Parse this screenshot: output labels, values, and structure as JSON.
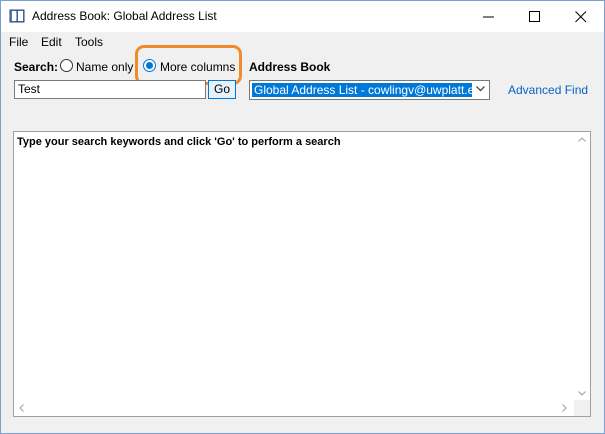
{
  "window": {
    "title": "Address Book: Global Address List",
    "icon": "address-book-icon"
  },
  "menu": [
    "File",
    "Edit",
    "Tools"
  ],
  "search": {
    "label": "Search:",
    "options": [
      {
        "label": "Name only",
        "selected": false
      },
      {
        "label": "More columns",
        "selected": true
      }
    ],
    "input_value": "Test",
    "go_label": "Go"
  },
  "address_book": {
    "label": "Address Book",
    "selected": "Global Address List - cowlingv@uwplatt.e"
  },
  "advanced_find": "Advanced Find",
  "results": {
    "message": "Type your search keywords and click 'Go' to perform a search"
  },
  "colors": {
    "highlight": "#f08a2c",
    "accent": "#0078d7",
    "link": "#0563c1"
  }
}
